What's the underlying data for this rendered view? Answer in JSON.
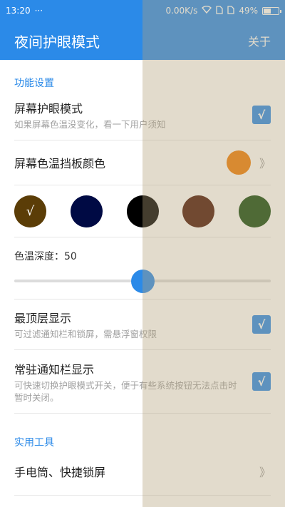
{
  "status_bar": {
    "time": "13:20",
    "dots": "···",
    "network_speed": "0.00K/s",
    "battery": "49%"
  },
  "app_bar": {
    "title": "夜间护眼模式",
    "action": "关于"
  },
  "sections": {
    "function_settings": "功能设置",
    "utilities": "实用工具"
  },
  "screen_eye_mode": {
    "title": "屏幕护眼模式",
    "subtitle": "如果屏幕色温没变化，看一下用户须知",
    "checked": true
  },
  "filter_color": {
    "title": "屏幕色温挡板颜色",
    "color": "#ef7c06"
  },
  "swatches": [
    {
      "color": "#5b3d07",
      "selected": true,
      "mark": "√"
    },
    {
      "color": "#000a44",
      "selected": false,
      "mark": ""
    },
    {
      "color": "#000000",
      "selected": false,
      "mark": ""
    },
    {
      "color": "#4a1405",
      "selected": false,
      "mark": ""
    },
    {
      "color": "#124a0d",
      "selected": false,
      "mark": ""
    }
  ],
  "depth": {
    "label": "色温深度：50",
    "value": 50
  },
  "top_layer": {
    "title": "最顶层显示",
    "subtitle": "可过滤通知栏和锁屏，需悬浮窗权限",
    "checked": true
  },
  "persistent_notify": {
    "title": "常驻通知栏显示",
    "subtitle": "可快速切换护眼模式开关，便于有些系统按钮无法点击时暂时关闭。",
    "checked": true
  },
  "flashlight": {
    "title": "手电筒、快捷锁屏"
  },
  "checkmark": "√",
  "chevron": "》"
}
